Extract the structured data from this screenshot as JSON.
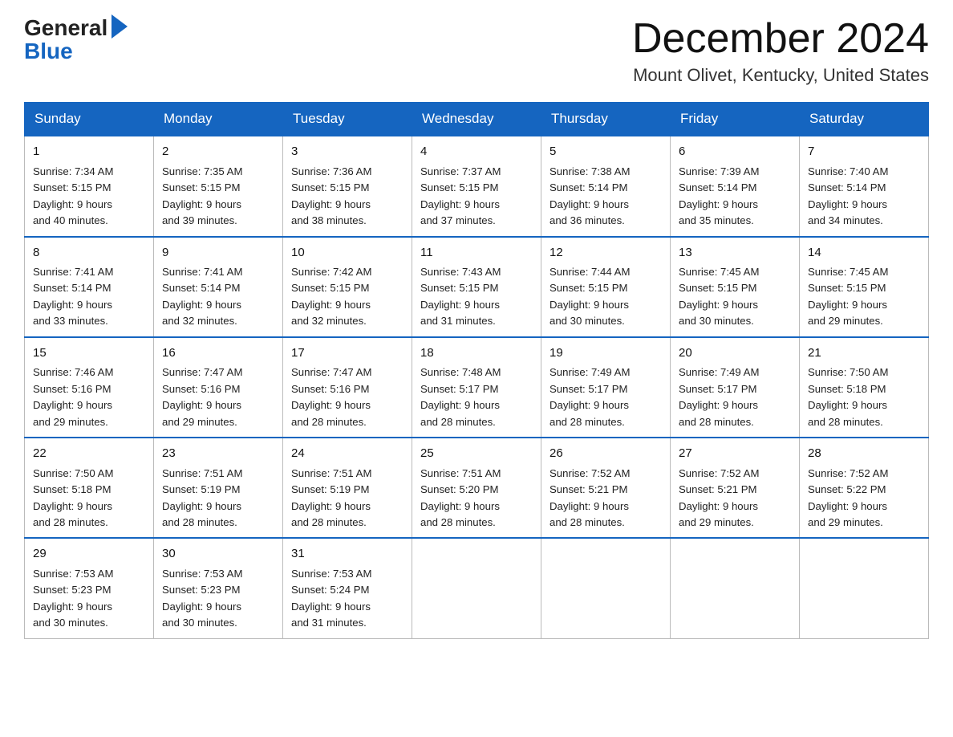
{
  "logo": {
    "general": "General",
    "blue": "Blue",
    "arrow": "▶"
  },
  "header": {
    "title": "December 2024",
    "subtitle": "Mount Olivet, Kentucky, United States"
  },
  "days": [
    "Sunday",
    "Monday",
    "Tuesday",
    "Wednesday",
    "Thursday",
    "Friday",
    "Saturday"
  ],
  "weeks": [
    [
      {
        "day": "1",
        "sunrise": "7:34 AM",
        "sunset": "5:15 PM",
        "daylight": "9 hours and 40 minutes."
      },
      {
        "day": "2",
        "sunrise": "7:35 AM",
        "sunset": "5:15 PM",
        "daylight": "9 hours and 39 minutes."
      },
      {
        "day": "3",
        "sunrise": "7:36 AM",
        "sunset": "5:15 PM",
        "daylight": "9 hours and 38 minutes."
      },
      {
        "day": "4",
        "sunrise": "7:37 AM",
        "sunset": "5:15 PM",
        "daylight": "9 hours and 37 minutes."
      },
      {
        "day": "5",
        "sunrise": "7:38 AM",
        "sunset": "5:14 PM",
        "daylight": "9 hours and 36 minutes."
      },
      {
        "day": "6",
        "sunrise": "7:39 AM",
        "sunset": "5:14 PM",
        "daylight": "9 hours and 35 minutes."
      },
      {
        "day": "7",
        "sunrise": "7:40 AM",
        "sunset": "5:14 PM",
        "daylight": "9 hours and 34 minutes."
      }
    ],
    [
      {
        "day": "8",
        "sunrise": "7:41 AM",
        "sunset": "5:14 PM",
        "daylight": "9 hours and 33 minutes."
      },
      {
        "day": "9",
        "sunrise": "7:41 AM",
        "sunset": "5:14 PM",
        "daylight": "9 hours and 32 minutes."
      },
      {
        "day": "10",
        "sunrise": "7:42 AM",
        "sunset": "5:15 PM",
        "daylight": "9 hours and 32 minutes."
      },
      {
        "day": "11",
        "sunrise": "7:43 AM",
        "sunset": "5:15 PM",
        "daylight": "9 hours and 31 minutes."
      },
      {
        "day": "12",
        "sunrise": "7:44 AM",
        "sunset": "5:15 PM",
        "daylight": "9 hours and 30 minutes."
      },
      {
        "day": "13",
        "sunrise": "7:45 AM",
        "sunset": "5:15 PM",
        "daylight": "9 hours and 30 minutes."
      },
      {
        "day": "14",
        "sunrise": "7:45 AM",
        "sunset": "5:15 PM",
        "daylight": "9 hours and 29 minutes."
      }
    ],
    [
      {
        "day": "15",
        "sunrise": "7:46 AM",
        "sunset": "5:16 PM",
        "daylight": "9 hours and 29 minutes."
      },
      {
        "day": "16",
        "sunrise": "7:47 AM",
        "sunset": "5:16 PM",
        "daylight": "9 hours and 29 minutes."
      },
      {
        "day": "17",
        "sunrise": "7:47 AM",
        "sunset": "5:16 PM",
        "daylight": "9 hours and 28 minutes."
      },
      {
        "day": "18",
        "sunrise": "7:48 AM",
        "sunset": "5:17 PM",
        "daylight": "9 hours and 28 minutes."
      },
      {
        "day": "19",
        "sunrise": "7:49 AM",
        "sunset": "5:17 PM",
        "daylight": "9 hours and 28 minutes."
      },
      {
        "day": "20",
        "sunrise": "7:49 AM",
        "sunset": "5:17 PM",
        "daylight": "9 hours and 28 minutes."
      },
      {
        "day": "21",
        "sunrise": "7:50 AM",
        "sunset": "5:18 PM",
        "daylight": "9 hours and 28 minutes."
      }
    ],
    [
      {
        "day": "22",
        "sunrise": "7:50 AM",
        "sunset": "5:18 PM",
        "daylight": "9 hours and 28 minutes."
      },
      {
        "day": "23",
        "sunrise": "7:51 AM",
        "sunset": "5:19 PM",
        "daylight": "9 hours and 28 minutes."
      },
      {
        "day": "24",
        "sunrise": "7:51 AM",
        "sunset": "5:19 PM",
        "daylight": "9 hours and 28 minutes."
      },
      {
        "day": "25",
        "sunrise": "7:51 AM",
        "sunset": "5:20 PM",
        "daylight": "9 hours and 28 minutes."
      },
      {
        "day": "26",
        "sunrise": "7:52 AM",
        "sunset": "5:21 PM",
        "daylight": "9 hours and 28 minutes."
      },
      {
        "day": "27",
        "sunrise": "7:52 AM",
        "sunset": "5:21 PM",
        "daylight": "9 hours and 29 minutes."
      },
      {
        "day": "28",
        "sunrise": "7:52 AM",
        "sunset": "5:22 PM",
        "daylight": "9 hours and 29 minutes."
      }
    ],
    [
      {
        "day": "29",
        "sunrise": "7:53 AM",
        "sunset": "5:23 PM",
        "daylight": "9 hours and 30 minutes."
      },
      {
        "day": "30",
        "sunrise": "7:53 AM",
        "sunset": "5:23 PM",
        "daylight": "9 hours and 30 minutes."
      },
      {
        "day": "31",
        "sunrise": "7:53 AM",
        "sunset": "5:24 PM",
        "daylight": "9 hours and 31 minutes."
      },
      null,
      null,
      null,
      null
    ]
  ]
}
